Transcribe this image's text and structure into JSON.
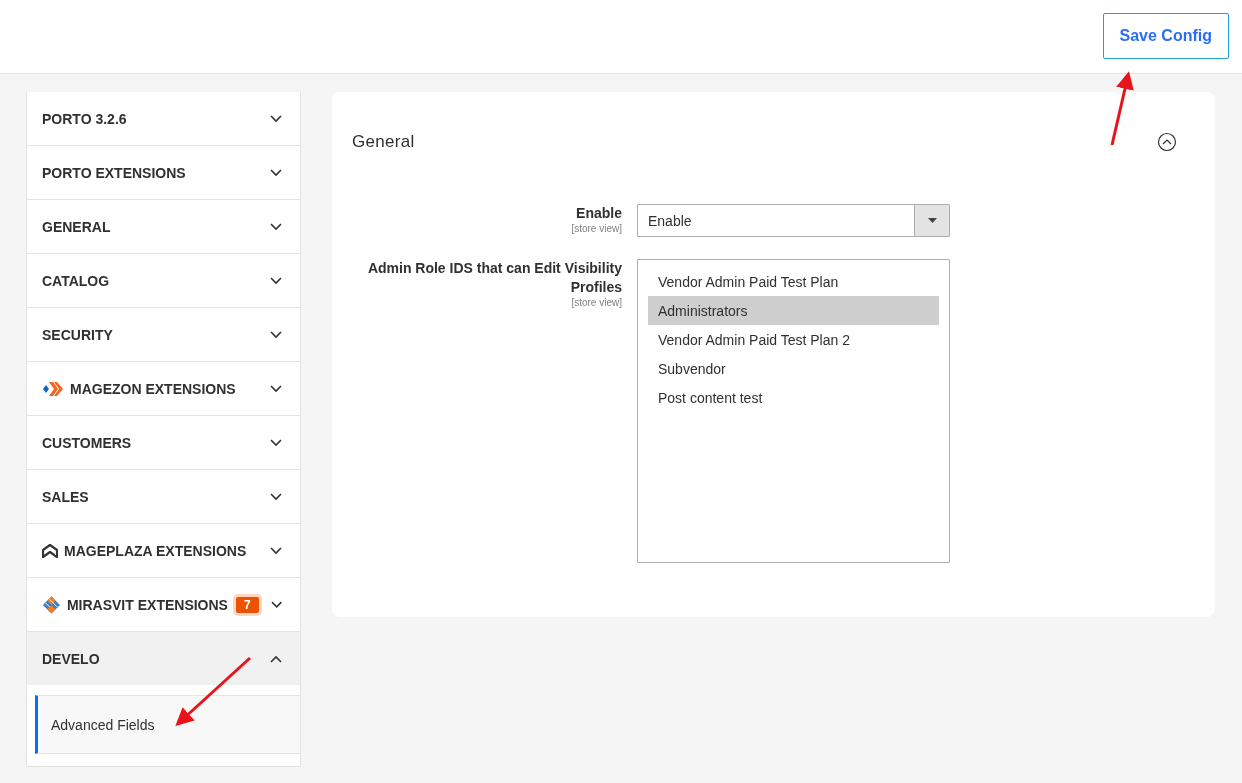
{
  "header": {
    "save_button": "Save Config"
  },
  "sidebar": {
    "sections": [
      {
        "kind": "plain",
        "label": "PORTO 3.2.6",
        "expanded": false
      },
      {
        "kind": "plain",
        "label": "PORTO EXTENSIONS",
        "expanded": false
      },
      {
        "kind": "plain",
        "label": "GENERAL",
        "expanded": false
      },
      {
        "kind": "plain",
        "label": "CATALOG",
        "expanded": false
      },
      {
        "kind": "plain",
        "label": "SECURITY",
        "expanded": false
      },
      {
        "kind": "magezon",
        "label": "MAGEZON EXTENSIONS",
        "expanded": false
      },
      {
        "kind": "plain",
        "label": "CUSTOMERS",
        "expanded": false
      },
      {
        "kind": "plain",
        "label": "SALES",
        "expanded": false
      },
      {
        "kind": "mageplaza",
        "label": "MAGEPLAZA EXTENSIONS",
        "expanded": false
      },
      {
        "kind": "mirasvit",
        "label": "MIRASVIT EXTENSIONS",
        "badge": "7",
        "expanded": false
      },
      {
        "kind": "plain",
        "label": "DEVELO",
        "expanded": true,
        "children": [
          {
            "label": "Advanced Fields",
            "selected": true
          }
        ]
      }
    ]
  },
  "panel": {
    "title": "General",
    "expanded": true,
    "fields": [
      {
        "kind": "select",
        "label": "Enable",
        "scope": "[store view]",
        "value": "Enable"
      },
      {
        "kind": "multiselect",
        "label": "Admin Role IDS that can Edit Visibility Profiles",
        "scope": "[store view]",
        "options": [
          {
            "label": "Vendor Admin Paid Test Plan",
            "selected": false
          },
          {
            "label": "Administrators",
            "selected": true
          },
          {
            "label": "Vendor Admin Paid Test Plan 2",
            "selected": false
          },
          {
            "label": "Subvendor",
            "selected": false
          },
          {
            "label": "Post content test",
            "selected": false
          }
        ]
      }
    ]
  }
}
